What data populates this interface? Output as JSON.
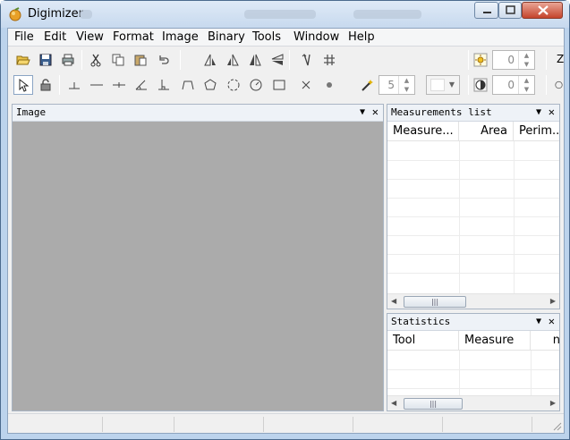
{
  "window": {
    "title": "Digimizer",
    "controls": {
      "minimize": "minimize",
      "maximize": "maximize",
      "close": "close"
    }
  },
  "menu": [
    "File",
    "Edit",
    "View",
    "Format",
    "Image",
    "Binary",
    "Tools",
    "Window",
    "Help"
  ],
  "toolbar1": {
    "icons": [
      "open-icon",
      "save-icon",
      "print-icon",
      "cut-icon",
      "copy-icon",
      "paste-icon",
      "undo-icon",
      "rotate-left-icon",
      "rotate-right-icon",
      "flip-horizontal-icon",
      "flip-vertical-icon",
      "calibrate-icon",
      "grid-icon"
    ],
    "brightness_value": "0",
    "zoom_label": "Z"
  },
  "toolbar2": {
    "icons": [
      "pointer-icon",
      "lock-icon",
      "marker-line-icon",
      "line-icon",
      "dimension-line-icon",
      "angle-icon",
      "perpendicular-icon",
      "polyline-icon",
      "polygon-icon",
      "circle-3pt-icon",
      "circle-center-icon",
      "rectangle-icon",
      "cross-icon",
      "dot-icon"
    ],
    "wand_value": "5",
    "contrast_value": "0"
  },
  "image_panel": {
    "title": "Image"
  },
  "measurements_panel": {
    "title": "Measurements list",
    "columns": [
      "Measure...",
      "Area",
      "Perim..."
    ]
  },
  "statistics_panel": {
    "title": "Statistics",
    "columns": [
      "Tool",
      "Measure",
      "n"
    ]
  },
  "colors": {
    "image_bg": "#ababab",
    "accent": "#3c78c8"
  }
}
